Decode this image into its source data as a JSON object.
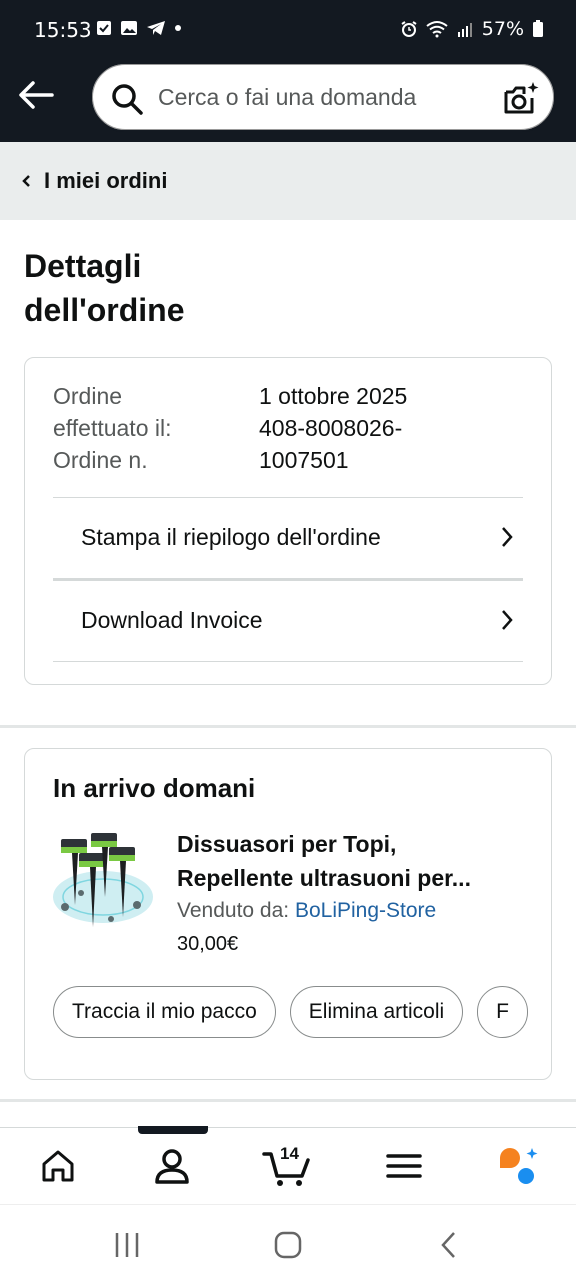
{
  "status_bar": {
    "time": "15:53",
    "battery": "57%"
  },
  "search": {
    "placeholder": "Cerca o fai una domanda"
  },
  "breadcrumb": {
    "label": "I miei ordini"
  },
  "page": {
    "title_line1": "Dettagli",
    "title_line2": "dell'ordine"
  },
  "order": {
    "placed_label_line1": "Ordine",
    "placed_label_line2": "effettuato il:",
    "placed_value": "1 ottobre 2025",
    "number_label": "Ordine n.",
    "number_value_line1": "408-8008026-",
    "number_value_line2": "1007501",
    "links": [
      {
        "label": "Stampa il riepilogo dell'ordine"
      },
      {
        "label": "Download Invoice"
      }
    ]
  },
  "shipment": {
    "title": "In arrivo domani",
    "product": {
      "name_line1": "Dissuasori per Topi,",
      "name_line2": "Repellente ultrasuoni per...",
      "seller_prefix": "Venduto da: ",
      "seller_name": "BoLiPing-Store",
      "price": "30,00€"
    },
    "actions": [
      {
        "label": "Traccia il mio pacco"
      },
      {
        "label": "Elimina articoli"
      },
      {
        "label": "F"
      }
    ]
  },
  "bottom_nav": {
    "cart_count": "14",
    "items": [
      "home-icon",
      "account-icon",
      "cart-icon",
      "menu-icon",
      "rufus-icon"
    ]
  },
  "colors": {
    "header_bg": "#131921",
    "breadcrumb_bg": "#eaeded",
    "link_blue": "#2162a1",
    "rufus_orange": "#f5821f",
    "rufus_blue": "#1a8ef0"
  }
}
